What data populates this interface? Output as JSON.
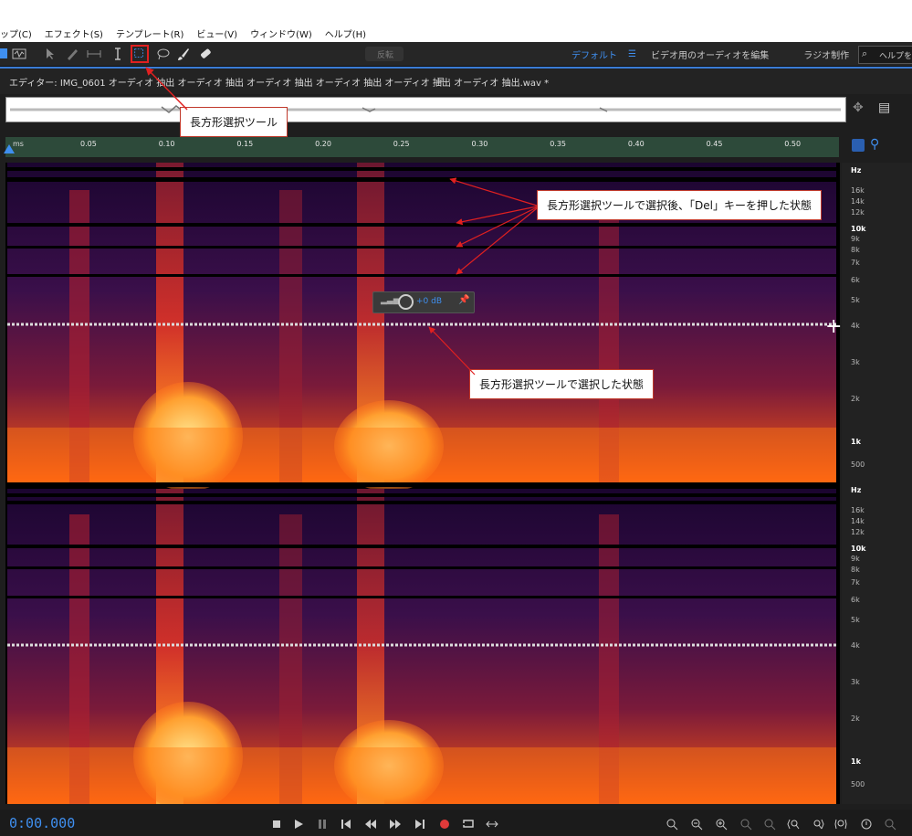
{
  "menu": [
    "ップ(C)",
    "エフェクト(S)",
    "テンプレート(R)",
    "ビュー(V)",
    "ウィンドウ(W)",
    "ヘルプ(H)"
  ],
  "toolbar": {
    "invert_label": "反転",
    "workspaces": [
      "デフォルト",
      "ビデオ用のオーディオを編集",
      "ラジオ制作"
    ],
    "help_placeholder": "ヘルプを"
  },
  "editor": {
    "title": "エディター: IMG_0601 オーディオ 抽出 オーディオ 抽出 オーディオ 抽出 オーディオ 抽出 オーディオ 抽出 オーディオ 抽出.wav *"
  },
  "timeline": {
    "start_label": "ms",
    "ticks": [
      "0.05",
      "0.10",
      "0.15",
      "0.20",
      "0.25",
      "0.30",
      "0.35",
      "0.40",
      "0.45",
      "0.50"
    ]
  },
  "freq_axis": {
    "unit": "Hz",
    "labels": [
      "16k",
      "14k",
      "12k",
      "10k",
      "9k",
      "8k",
      "7k",
      "6k",
      "5k",
      "4k",
      "3k",
      "2k",
      "1k",
      "500"
    ]
  },
  "hud": {
    "gain": "+0 dB"
  },
  "annotations": {
    "tool": "長方形選択ツール",
    "deleted": "長方形選択ツールで選択後、「Del」キーを押した状態",
    "selected": "長方形選択ツールで選択した状態"
  },
  "transport": {
    "timecode": "0:00.000"
  },
  "colors": {
    "accent": "#3f8ff0",
    "highlight": "#e02020",
    "record": "#e03a3a"
  },
  "icons": [
    "spectral-view-icon",
    "waveform-view-icon",
    "move-tool-icon",
    "razor-tool-icon",
    "slip-tool-icon",
    "time-selection-icon",
    "marquee-tool-icon",
    "lasso-tool-icon",
    "brush-tool-icon",
    "spot-healing-icon",
    "search-icon"
  ]
}
